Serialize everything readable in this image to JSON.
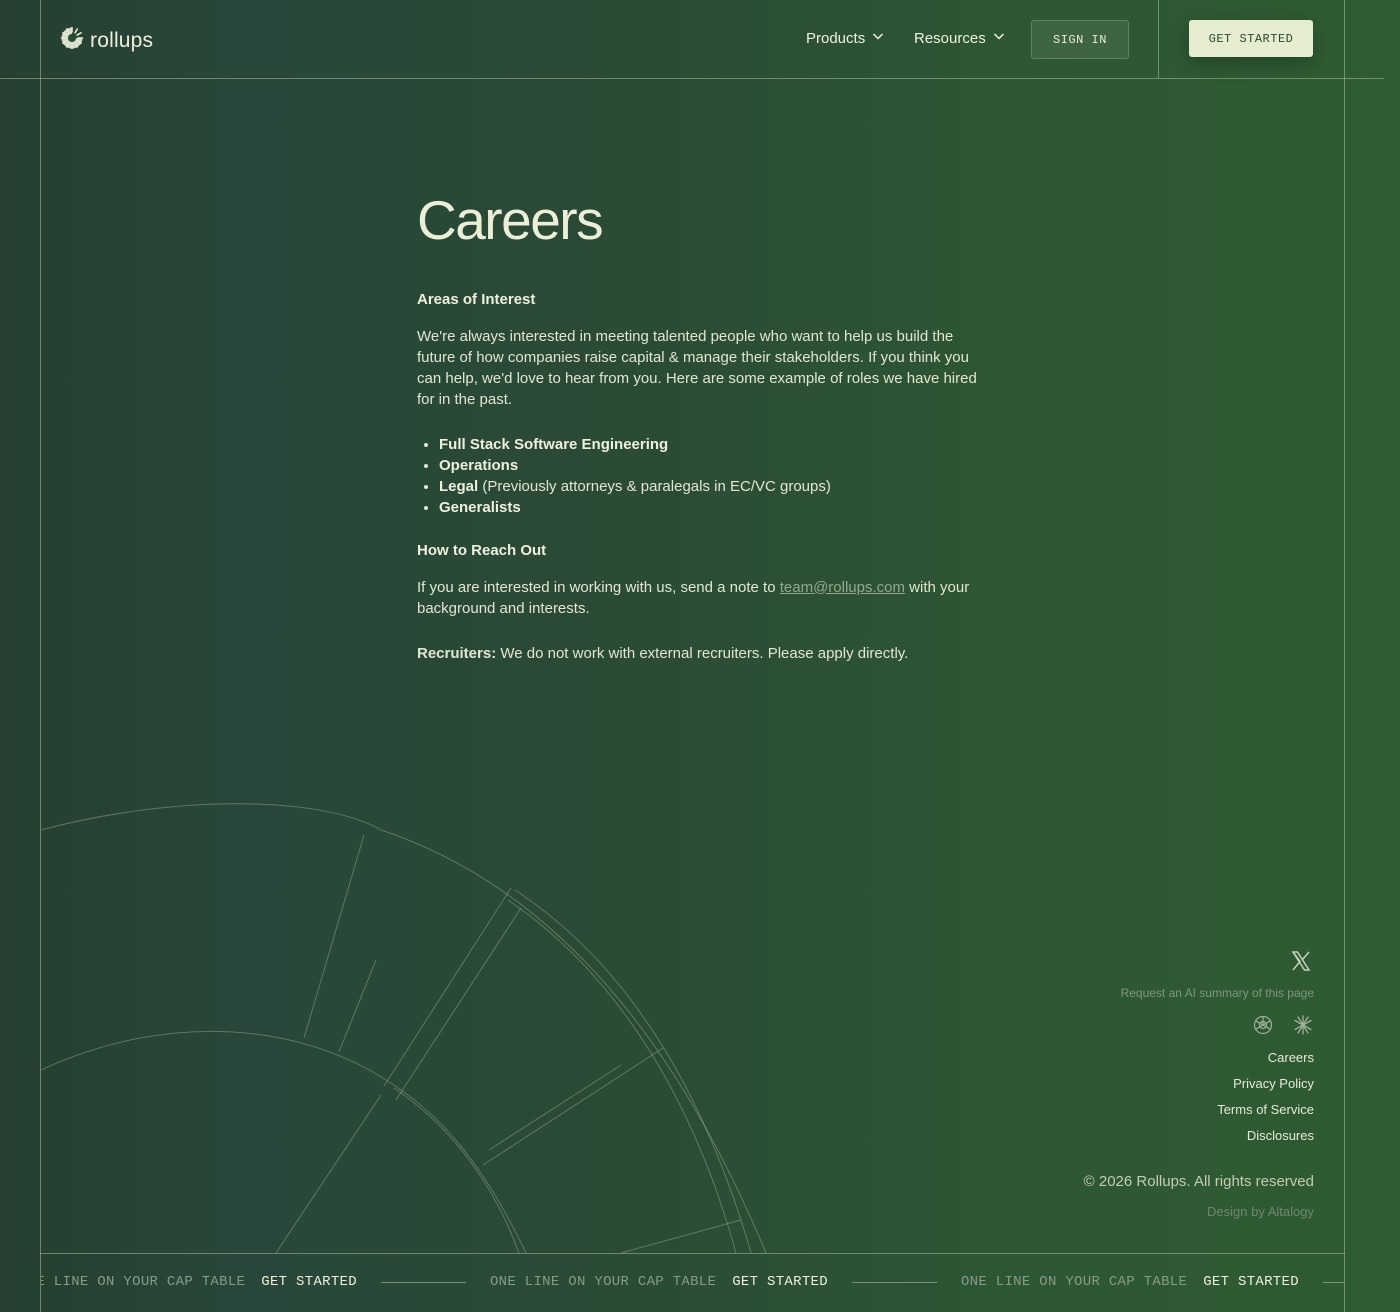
{
  "header": {
    "logo_text": "rollups",
    "nav": [
      {
        "label": "Products"
      },
      {
        "label": "Resources"
      }
    ],
    "sign_in_label": "SIGN IN",
    "get_started_label": "GET STARTED"
  },
  "main": {
    "title": "Careers",
    "areas_heading": "Areas of Interest",
    "intro": "We're always interested in meeting talented people who want to help us build the future of how companies raise capital & manage their stakeholders. If you think you can help, we'd love to hear from you. Here are some example of roles we have hired for in the past.",
    "roles": [
      {
        "name": "Full Stack Software Engineering",
        "note": ""
      },
      {
        "name": "Operations",
        "note": ""
      },
      {
        "name": "Legal",
        "note": "(Previously attorneys & paralegals in EC/VC groups)"
      },
      {
        "name": "Generalists",
        "note": ""
      }
    ],
    "reach_heading": "How to Reach Out",
    "reach_text_before": "If you are interested in working with us, send a note to",
    "reach_email": "team@rollups.com",
    "reach_text_after": "with your background and interests.",
    "recruiters_label": "Recruiters:",
    "recruiters_text": "We do not work with external recruiters. Please apply directly."
  },
  "footer": {
    "ai_summary": "Request an AI summary of this page",
    "links": [
      "Careers",
      "Privacy Policy",
      "Terms of Service",
      "Disclosures"
    ],
    "copyright": "© 2026  Rollups. All rights reserved",
    "design_by": "Design by Altalogy"
  },
  "marquee": {
    "tagline": "ONE LINE ON YOUR CAP TABLE",
    "cta": "GET STARTED"
  },
  "colors": {
    "background": "#2a4b34",
    "accent_button": "#e6ecd0",
    "text": "#e4e8d4",
    "muted": "#869c84"
  }
}
